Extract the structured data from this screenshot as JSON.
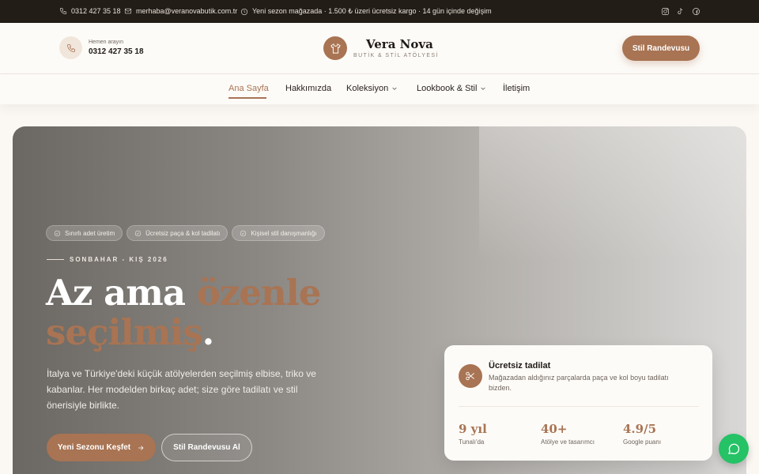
{
  "topbar": {
    "phone": "0312 427 35 18",
    "email": "merhaba@veranovabutik.com.tr",
    "notice": "Yeni sezon mağazada · 1.500 ₺ üzeri ücretsiz kargo · 14 gün içinde değişim",
    "phone_icon": "phone-icon",
    "email_icon": "mail-icon",
    "notice_icon": "clock-icon",
    "social_icons": [
      "instagram-icon",
      "tiktok-icon",
      "facebook-icon"
    ]
  },
  "header": {
    "call_label": "Hemen arayın",
    "call_number": "0312 427 35 18",
    "brand_name": "Vera Nova",
    "brand_tagline": "BUTİK & STİL ATÖLYESİ",
    "cta": "Stil Randevusu",
    "logo_icon": "shirt-icon"
  },
  "nav": {
    "items": [
      {
        "label": "Ana Sayfa",
        "active": true,
        "dropdown": false
      },
      {
        "label": "Hakkımızda",
        "active": false,
        "dropdown": false
      },
      {
        "label": "Koleksiyon",
        "active": false,
        "dropdown": true
      },
      {
        "label": "Lookbook & Stil",
        "active": false,
        "dropdown": true
      },
      {
        "label": "İletişim",
        "active": false,
        "dropdown": false
      }
    ]
  },
  "hero": {
    "chips": [
      "Sınırlı adet üretim",
      "Ücretsiz paça & kol tadilatı",
      "Kişisel stil danışmanlığı"
    ],
    "season": "SONBAHAR - KIŞ 2026",
    "headline_plain": "Az ama ",
    "headline_accent_1": "özenle",
    "headline_accent_2": "seçilmiş",
    "headline_end": ".",
    "description": "İtalya ve Türkiye'deki küçük atölyelerden seçilmiş elbise, triko ve kabanlar. Her modelden birkaç adet; size göre tadilatı ve stil önerisiyle birlikte.",
    "primary_button": "Yeni Sezonu Keşfet",
    "secondary_button": "Stil Randevusu Al"
  },
  "card": {
    "title": "Ücretsiz tadilat",
    "text": "Mağazadan aldığınız parçalarda paça ve kol boyu tadilatı bizden.",
    "icon": "scissors-icon",
    "stats": [
      {
        "value": "9 yıl",
        "label": "Tunalı'da"
      },
      {
        "value": "40+",
        "label": "Atölye ve tasarımcı"
      },
      {
        "value": "4.9/5",
        "label": "Google puanı"
      }
    ]
  },
  "colors": {
    "accent": "#a87453",
    "topbar_bg": "#231d18",
    "whatsapp": "#25c266"
  }
}
